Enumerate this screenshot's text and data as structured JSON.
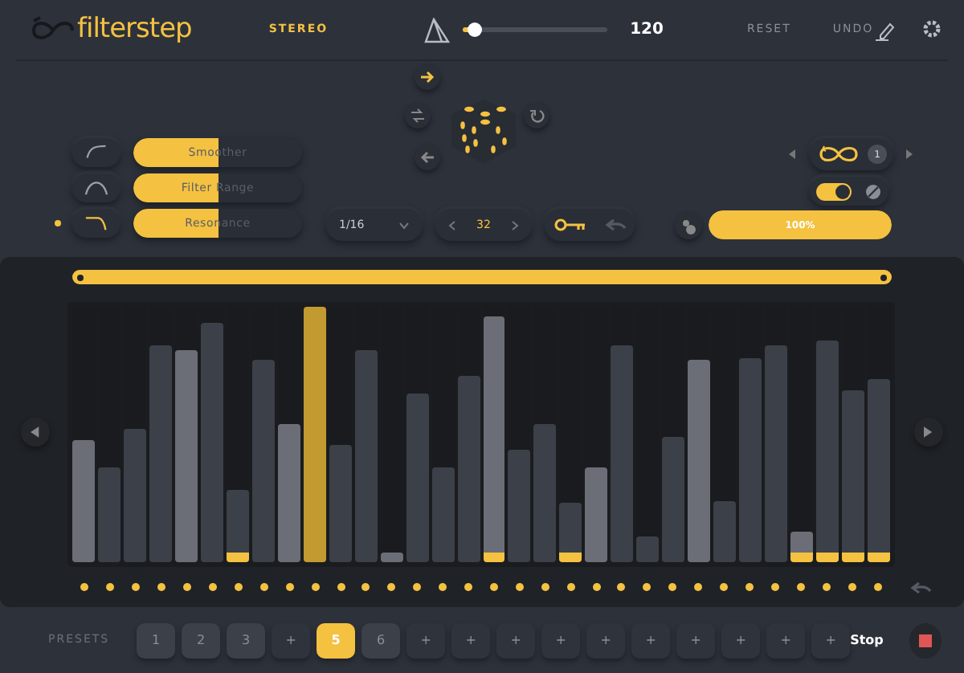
{
  "header": {
    "logo": "filterstep",
    "mode": "STEREO",
    "tempo": {
      "level": 0.08,
      "value": "120"
    },
    "buttons": [
      "RESET",
      "UNDO"
    ]
  },
  "sliders": [
    {
      "label": "Smoother",
      "level": 0.5,
      "selected": false,
      "kind": "rise"
    },
    {
      "label": "Filter Range",
      "level": 0.5,
      "selected": false,
      "kind": "arch"
    },
    {
      "label": "Resonance",
      "level": 0.5,
      "selected": true,
      "kind": "fall"
    }
  ],
  "division": "1/16",
  "steps_count": "32",
  "loop": {
    "count": "1",
    "lit": true
  },
  "amount": {
    "level": 1,
    "value": "100%"
  },
  "steps": [
    {
      "level": 0.48,
      "accent": true,
      "glide": false,
      "selected": false
    },
    {
      "level": 0.37,
      "accent": false,
      "glide": false,
      "selected": false
    },
    {
      "level": 0.52,
      "accent": false,
      "glide": false,
      "selected": false
    },
    {
      "level": 0.85,
      "accent": false,
      "glide": false,
      "selected": false
    },
    {
      "level": 0.83,
      "accent": true,
      "glide": false,
      "selected": false
    },
    {
      "level": 0.94,
      "accent": false,
      "glide": false,
      "selected": false
    },
    {
      "level": 0.28,
      "accent": false,
      "glide": true,
      "selected": false
    },
    {
      "level": 0.79,
      "accent": false,
      "glide": false,
      "selected": false
    },
    {
      "level": 0.54,
      "accent": true,
      "glide": false,
      "selected": false
    },
    {
      "level": 1,
      "accent": false,
      "glide": false,
      "selected": true
    },
    {
      "level": 0.46,
      "accent": false,
      "glide": false,
      "selected": false
    },
    {
      "level": 0.83,
      "accent": false,
      "glide": false,
      "selected": false
    },
    {
      "level": 0.04,
      "accent": true,
      "glide": false,
      "selected": false
    },
    {
      "level": 0.66,
      "accent": false,
      "glide": false,
      "selected": false
    },
    {
      "level": 0.37,
      "accent": false,
      "glide": false,
      "selected": false
    },
    {
      "level": 0.73,
      "accent": false,
      "glide": false,
      "selected": false
    },
    {
      "level": 0.96,
      "accent": true,
      "glide": true,
      "selected": false
    },
    {
      "level": 0.44,
      "accent": false,
      "glide": false,
      "selected": false
    },
    {
      "level": 0.54,
      "accent": false,
      "glide": false,
      "selected": false
    },
    {
      "level": 0.23,
      "accent": false,
      "glide": true,
      "selected": false
    },
    {
      "level": 0.37,
      "accent": true,
      "glide": false,
      "selected": false
    },
    {
      "level": 0.85,
      "accent": false,
      "glide": false,
      "selected": false
    },
    {
      "level": 0.1,
      "accent": false,
      "glide": false,
      "selected": false
    },
    {
      "level": 0.49,
      "accent": false,
      "glide": false,
      "selected": false
    },
    {
      "level": 0.79,
      "accent": true,
      "glide": false,
      "selected": false
    },
    {
      "level": 0.24,
      "accent": false,
      "glide": false,
      "selected": false
    },
    {
      "level": 0.8,
      "accent": false,
      "glide": false,
      "selected": false
    },
    {
      "level": 0.85,
      "accent": false,
      "glide": false,
      "selected": false
    },
    {
      "level": 0.12,
      "accent": true,
      "glide": true,
      "selected": false
    },
    {
      "level": 0.87,
      "accent": false,
      "glide": true,
      "selected": false
    },
    {
      "level": 0.67,
      "accent": false,
      "glide": true,
      "selected": false
    },
    {
      "level": 0.72,
      "accent": false,
      "glide": true,
      "selected": false
    }
  ],
  "presets_label": "PRESETS",
  "presets": [
    {
      "label": "1",
      "filled": true,
      "selected": false
    },
    {
      "label": "2",
      "filled": true,
      "selected": false
    },
    {
      "label": "3",
      "filled": true,
      "selected": false
    },
    {
      "label": "+",
      "filled": false,
      "selected": false
    },
    {
      "label": "5",
      "filled": true,
      "selected": true
    },
    {
      "label": "6",
      "filled": true,
      "selected": false
    },
    {
      "label": "+",
      "filled": false,
      "selected": false
    },
    {
      "label": "+",
      "filled": false,
      "selected": false
    },
    {
      "label": "+",
      "filled": false,
      "selected": false
    },
    {
      "label": "+",
      "filled": false,
      "selected": false
    },
    {
      "label": "+",
      "filled": false,
      "selected": false
    },
    {
      "label": "+",
      "filled": false,
      "selected": false
    },
    {
      "label": "+",
      "filled": false,
      "selected": false
    },
    {
      "label": "+",
      "filled": false,
      "selected": false
    },
    {
      "label": "+",
      "filled": false,
      "selected": false
    },
    {
      "label": "+",
      "filled": false,
      "selected": false
    }
  ],
  "transport": {
    "label": "Stop"
  }
}
